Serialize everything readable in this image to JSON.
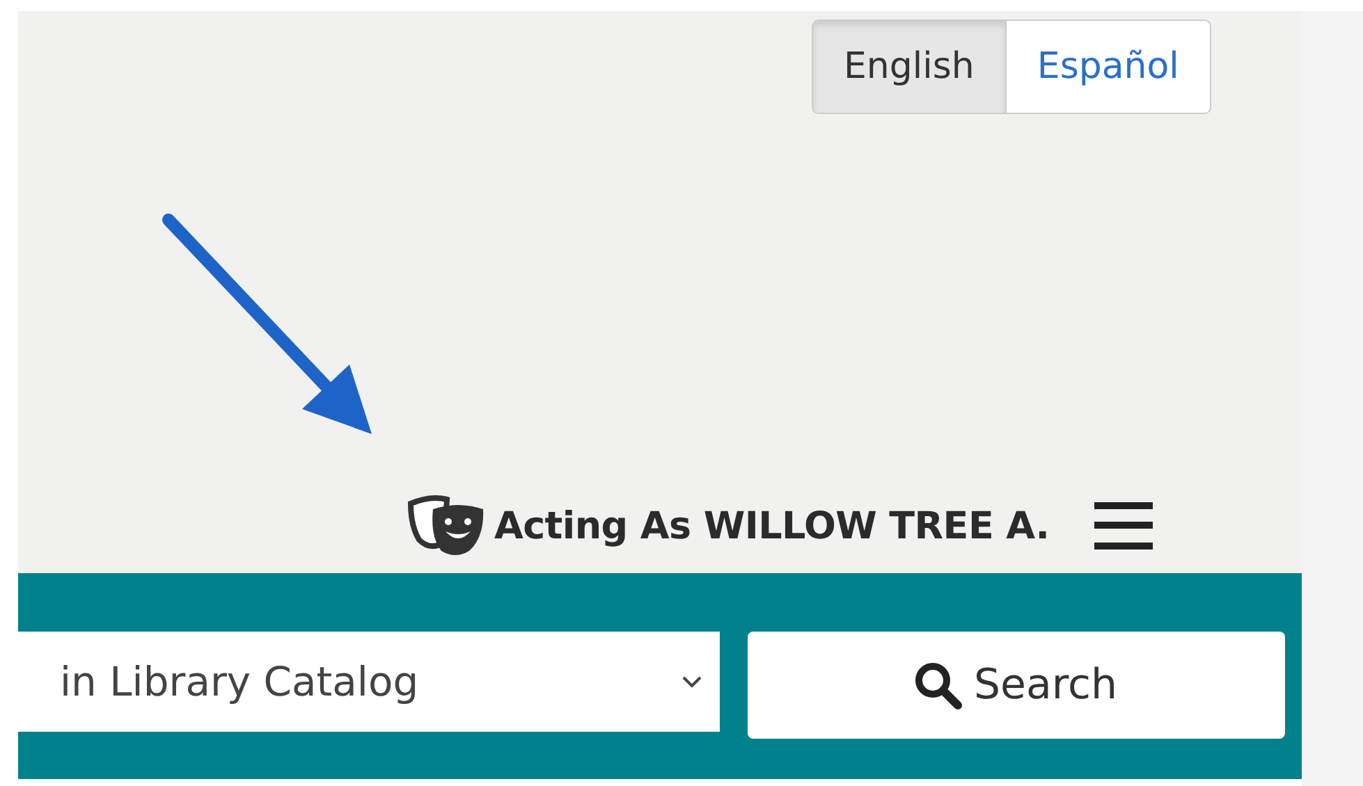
{
  "language_toggle": [
    {
      "label": "English",
      "selected": true
    },
    {
      "label": "Español",
      "selected": false
    }
  ],
  "account": {
    "label": "Acting As WILLOW TREE A."
  },
  "search": {
    "scope": "in Library Catalog",
    "button": "Search"
  }
}
